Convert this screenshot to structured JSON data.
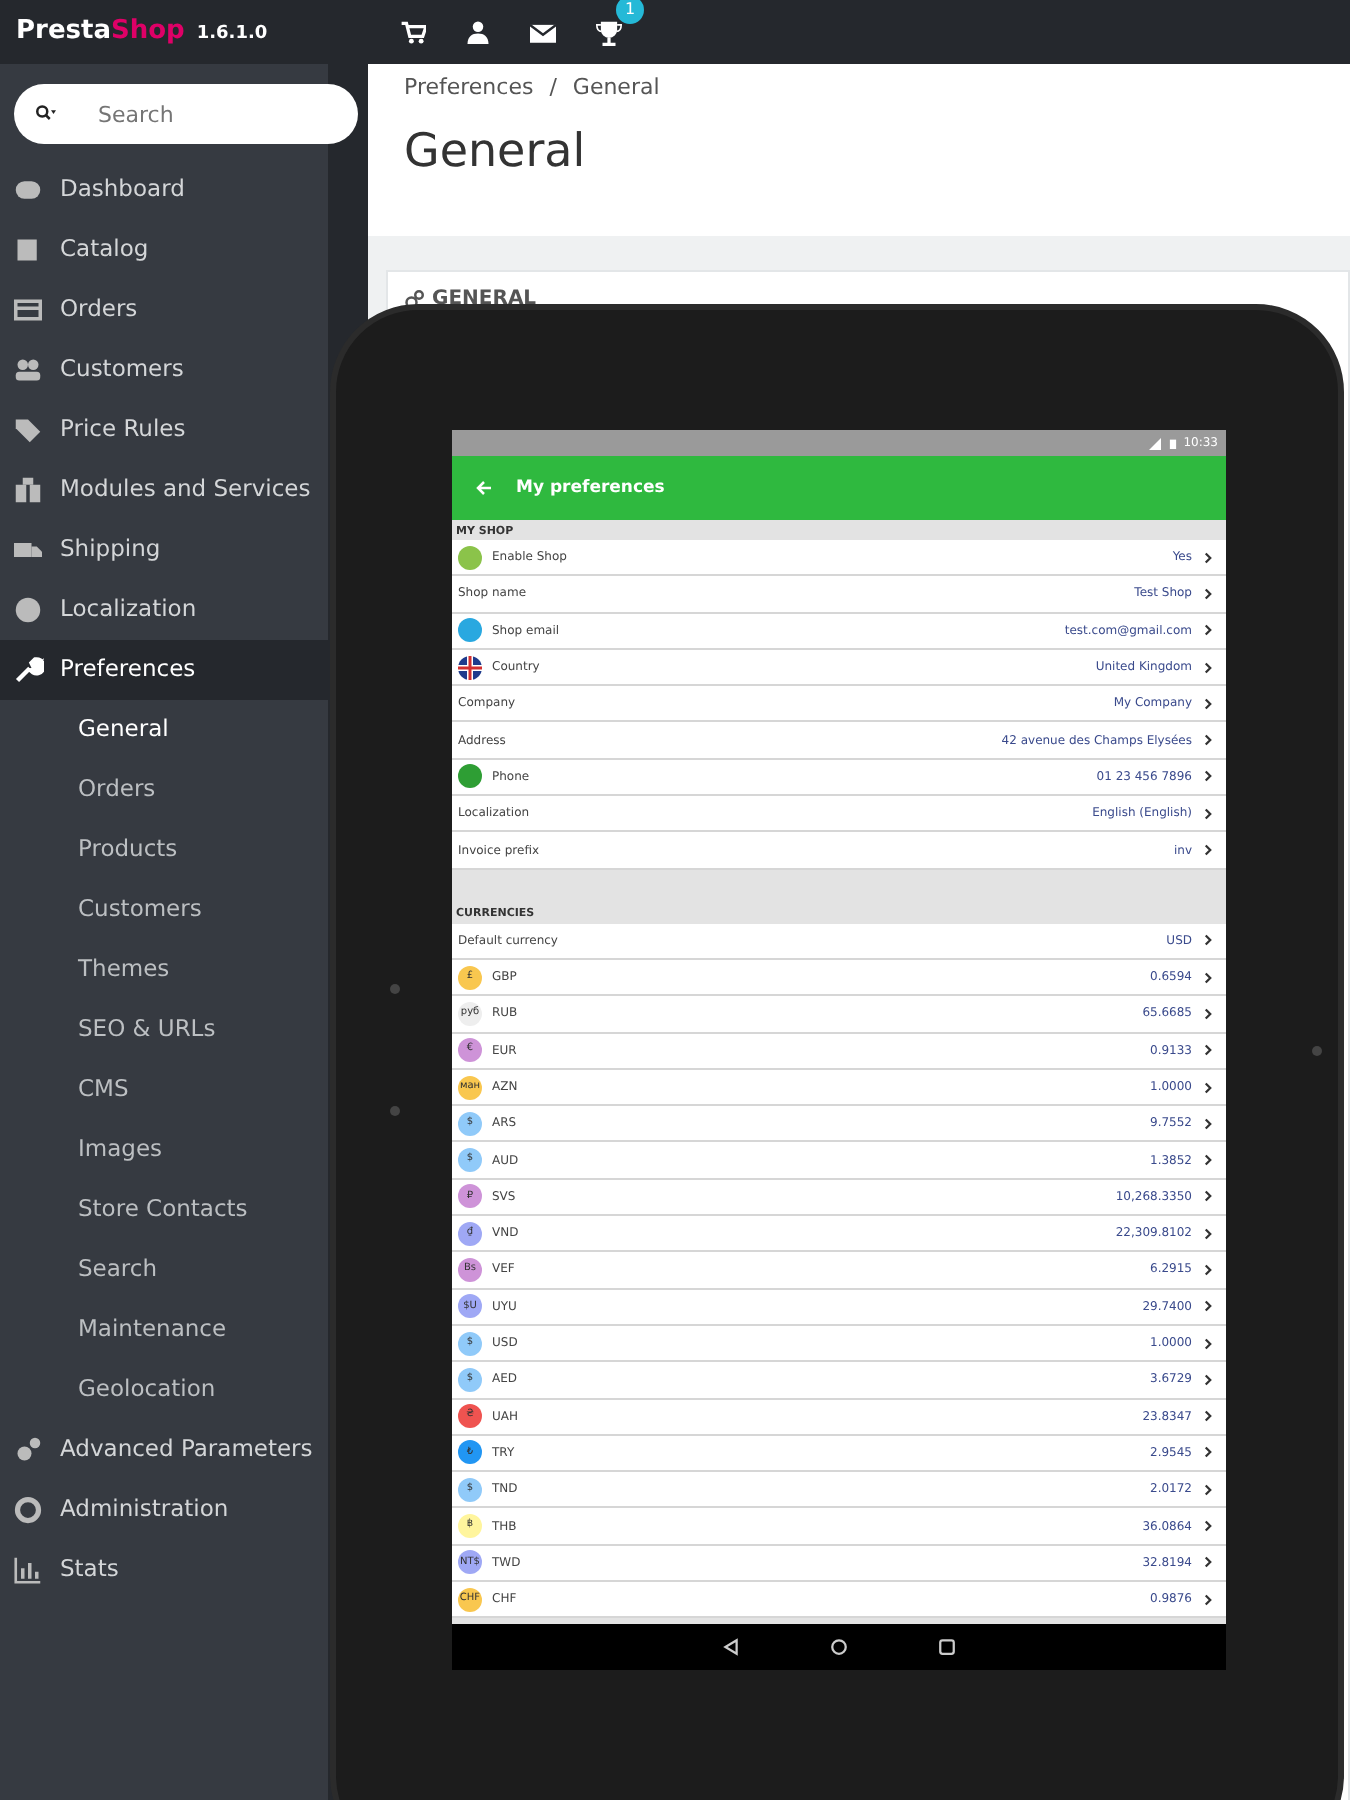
{
  "topbar": {
    "logo_first": "Presta",
    "logo_second": "Shop",
    "version": "1.6.1.0",
    "notification_count": "1"
  },
  "sidebar": {
    "search": {
      "placeholder": "Search"
    },
    "items": [
      {
        "label": "Dashboard",
        "selected": false
      },
      {
        "label": "Catalog",
        "selected": false
      },
      {
        "label": "Orders",
        "selected": false
      },
      {
        "label": "Customers",
        "selected": false
      },
      {
        "label": "Price Rules",
        "selected": false
      },
      {
        "label": "Modules and Services",
        "selected": false
      },
      {
        "label": "Shipping",
        "selected": false
      },
      {
        "label": "Localization",
        "selected": false
      },
      {
        "label": "Preferences",
        "selected": true,
        "children": [
          {
            "label": "General",
            "selected": true
          },
          {
            "label": "Orders",
            "selected": false
          },
          {
            "label": "Products",
            "selected": false
          },
          {
            "label": "Customers",
            "selected": false
          },
          {
            "label": "Themes",
            "selected": false
          },
          {
            "label": "SEO & URLs",
            "selected": false
          },
          {
            "label": "CMS",
            "selected": false
          },
          {
            "label": "Images",
            "selected": false
          },
          {
            "label": "Store Contacts",
            "selected": false
          },
          {
            "label": "Search",
            "selected": false
          },
          {
            "label": "Maintenance",
            "selected": false
          },
          {
            "label": "Geolocation",
            "selected": false
          }
        ]
      },
      {
        "label": "Advanced Parameters",
        "selected": false
      },
      {
        "label": "Administration",
        "selected": false
      },
      {
        "label": "Stats",
        "selected": false
      }
    ]
  },
  "breadcrumb": {
    "separator": "/",
    "items": [
      "Preferences",
      "General"
    ]
  },
  "page_title": "General",
  "panel": {
    "title": "GENERAL"
  },
  "tablet": {
    "status_time": "10:33",
    "app_title": "My preferences",
    "sections": [
      {
        "title": "MY SHOP",
        "rows": [
          {
            "kind": "icon",
            "color": "#8bc34a",
            "label": "Enable Shop",
            "value": "Yes"
          },
          {
            "kind": "plain",
            "label": "Shop name",
            "value": "Test Shop"
          },
          {
            "kind": "icon",
            "color": "#29a8e0",
            "label": "Shop email",
            "value": "test.com@gmail.com"
          },
          {
            "kind": "flag",
            "label": "Country",
            "value": "United Kingdom"
          },
          {
            "kind": "plain",
            "label": "Company",
            "value": "My Company"
          },
          {
            "kind": "plain",
            "label": "Address",
            "value": "42 avenue des Champs Elysées"
          },
          {
            "kind": "icon",
            "color": "#2e9e34",
            "label": "Phone",
            "value": "01 23 456 7896"
          },
          {
            "kind": "plain",
            "label": "Localization",
            "value": "English (English)"
          },
          {
            "kind": "plain",
            "label": "Invoice prefix",
            "value": "inv"
          }
        ]
      },
      {
        "title": "CURRENCIES",
        "rows": [
          {
            "kind": "plain",
            "label": "Default currency",
            "value": "USD"
          },
          {
            "kind": "icon",
            "color": "#f9c74f",
            "symbol": "£",
            "label": "GBP",
            "value": "0.6594"
          },
          {
            "kind": "icon",
            "color": "#eeeeee",
            "symbol": "руб",
            "label": "RUB",
            "value": "65.6685"
          },
          {
            "kind": "icon",
            "color": "#ce93d8",
            "symbol": "€",
            "label": "EUR",
            "value": "0.9133"
          },
          {
            "kind": "icon",
            "color": "#f9c74f",
            "symbol": "ман",
            "label": "AZN",
            "value": "1.0000"
          },
          {
            "kind": "icon",
            "color": "#90caf9",
            "symbol": "$",
            "label": "ARS",
            "value": "9.7552"
          },
          {
            "kind": "icon",
            "color": "#90caf9",
            "symbol": "$",
            "label": "AUD",
            "value": "1.3852"
          },
          {
            "kind": "icon",
            "color": "#ce93d8",
            "symbol": "₽",
            "label": "SVS",
            "value": "10,268.3350"
          },
          {
            "kind": "icon",
            "color": "#9fa8f5",
            "symbol": "₫",
            "label": "VND",
            "value": "22,309.8102"
          },
          {
            "kind": "icon",
            "color": "#ce93d8",
            "symbol": "Bs",
            "label": "VEF",
            "value": "6.2915"
          },
          {
            "kind": "icon",
            "color": "#9fa8f5",
            "symbol": "$U",
            "label": "UYU",
            "value": "29.7400"
          },
          {
            "kind": "icon",
            "color": "#90caf9",
            "symbol": "$",
            "label": "USD",
            "value": "1.0000"
          },
          {
            "kind": "icon",
            "color": "#90caf9",
            "symbol": "$",
            "label": "AED",
            "value": "3.6729"
          },
          {
            "kind": "icon",
            "color": "#ef5350",
            "symbol": "₴",
            "label": "UAH",
            "value": "23.8347"
          },
          {
            "kind": "icon",
            "color": "#2196f3",
            "symbol": "₺",
            "label": "TRY",
            "value": "2.9545"
          },
          {
            "kind": "icon",
            "color": "#90caf9",
            "symbol": "$",
            "label": "TND",
            "value": "2.0172"
          },
          {
            "kind": "icon",
            "color": "#fff59d",
            "symbol": "฿",
            "label": "THB",
            "value": "36.0864"
          },
          {
            "kind": "icon",
            "color": "#9fa8f5",
            "symbol": "NT$",
            "label": "TWD",
            "value": "32.8194"
          },
          {
            "kind": "icon",
            "color": "#f9c74f",
            "symbol": "CHF",
            "label": "CHF",
            "value": "0.9876"
          }
        ]
      }
    ]
  }
}
